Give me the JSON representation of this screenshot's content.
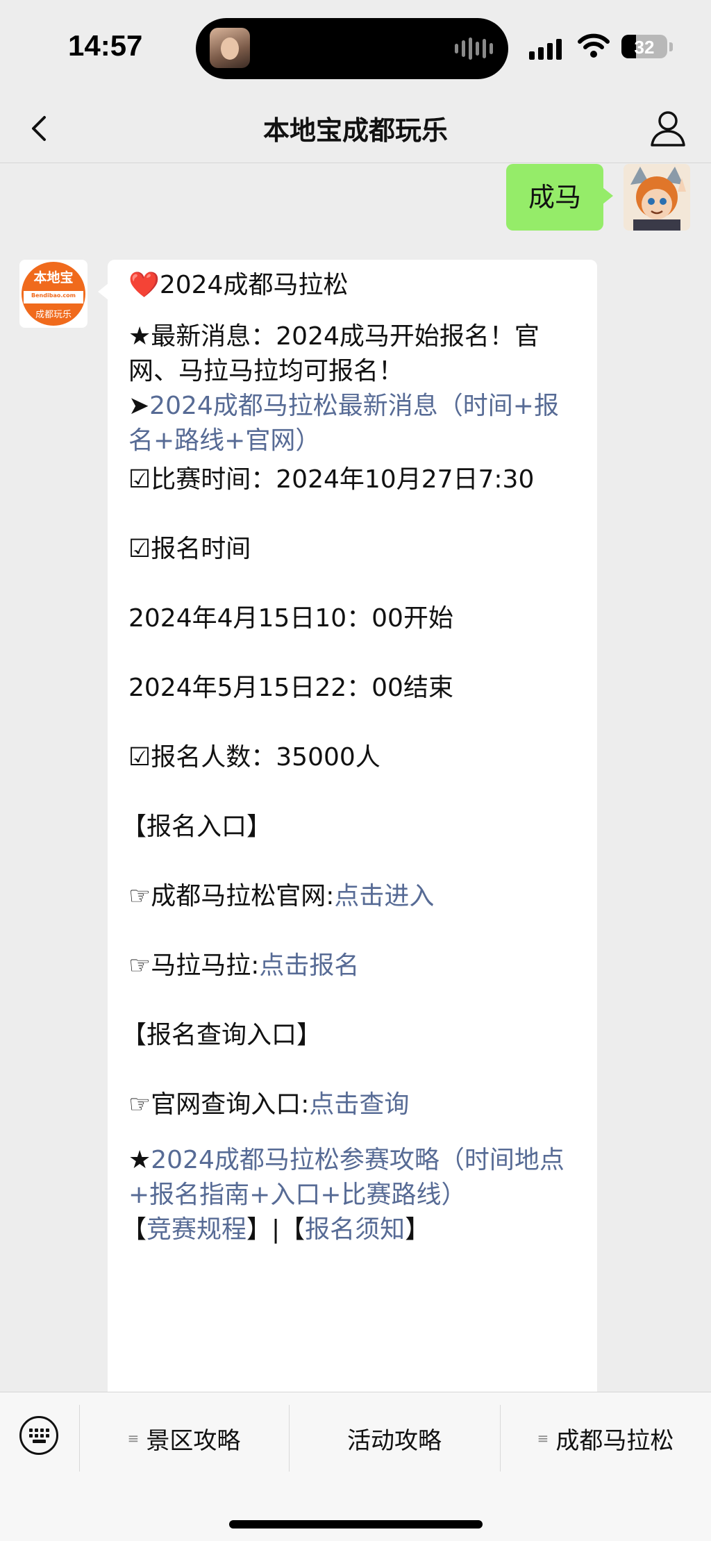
{
  "status_bar": {
    "time": "14:57",
    "battery": "32",
    "battery_level_pct": 32
  },
  "nav": {
    "title": "本地宝成都玩乐"
  },
  "chat": {
    "sent_message": "成马",
    "bot_avatar": {
      "line1": "本地宝",
      "line2": "Bendibao.com",
      "line3": "成都玩乐"
    },
    "reply": {
      "heading": "❤️2024成都马拉松",
      "news": "★最新消息：2024成马开始报名！官网、马拉马拉均可报名！",
      "news_link_prefix": "➤",
      "news_link": "2024成都马拉松最新消息（时间+报名+路线+官网）",
      "race_time": "☑比赛时间：2024年10月27日7:30",
      "signup_time_label": "☑报名时间",
      "signup_start": "2024年4月15日10：00开始",
      "signup_end": "2024年5月15日22：00结束",
      "signup_count": "☑报名人数：35000人",
      "entry_header": "【报名入口】",
      "official_site_label": "☞成都马拉松官网:",
      "official_site_link": "点击进入",
      "malamala_label": "☞马拉马拉:",
      "malamala_link": "点击报名",
      "query_header": "【报名查询入口】",
      "query_label": "☞官网查询入口:",
      "query_link": "点击查询",
      "guide_prefix": "★",
      "guide_link": "2024成都马拉松参赛攻略（时间地点+报名指南+入口+比赛路线）",
      "bottom_open": "【",
      "rules_link": "竞赛规程",
      "bottom_sep": "】|【",
      "notice_link": "报名须知",
      "bottom_close": "】"
    }
  },
  "bottom_menu": {
    "items": [
      {
        "label": "景区攻略",
        "icon": "menu-list-icon"
      },
      {
        "label": "活动攻略"
      },
      {
        "label": "成都马拉松",
        "icon": "menu-list-icon"
      }
    ]
  },
  "colors": {
    "link": "#576b95",
    "sent_bubble": "#95ec69",
    "brand": "#f06a1c"
  }
}
